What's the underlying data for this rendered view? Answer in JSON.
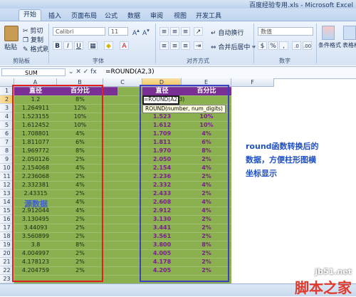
{
  "window": {
    "title": "百度经验专用.xls - Microsoft Excel"
  },
  "tabs": [
    "开始",
    "插入",
    "页面布局",
    "公式",
    "数据",
    "审阅",
    "视图",
    "开发工具"
  ],
  "ribbon": {
    "paste": "粘贴",
    "cut": "剪切",
    "copy": "复制",
    "format_painter": "格式刷",
    "font_name": "Calibri",
    "font_size": "11",
    "bold": "B",
    "italic": "I",
    "underline": "U",
    "wrap_text": "自动换行",
    "merge_center": "合并后居中",
    "number_format": "数值",
    "conditional_format": "条件格式",
    "table_format": "表格格",
    "groups": {
      "clipboard": "剪贴板",
      "font": "字体",
      "alignment": "对齐方式",
      "number": "数字"
    }
  },
  "formula_bar": {
    "name_box": "SUM",
    "icons": "⌄ ✕ ✓ fx",
    "formula": "=ROUND(A2,3)"
  },
  "columns": [
    "A",
    "B",
    "C",
    "D",
    "E",
    "F"
  ],
  "rows": [
    "1",
    "2",
    "3",
    "4",
    "5",
    "6",
    "7",
    "8",
    "9",
    "10",
    "11",
    "12",
    "13",
    "14",
    "15",
    "16",
    "17",
    "18",
    "19",
    "20",
    "21",
    "22",
    "23"
  ],
  "sheet": {
    "header_left": [
      "直径",
      "百分比"
    ],
    "header_right": [
      "直径",
      "百分比"
    ],
    "left_rows": [
      [
        "1.2",
        "8%"
      ],
      [
        "1.264911",
        "12%"
      ],
      [
        "1.523155",
        "10%"
      ],
      [
        "1.612452",
        "10%"
      ],
      [
        "1.708801",
        "4%"
      ],
      [
        "1.811077",
        "6%"
      ],
      [
        "1.969772",
        "8%"
      ],
      [
        "2.050126",
        "2%"
      ],
      [
        "2.154068",
        "4%"
      ],
      [
        "2.236068",
        "2%"
      ],
      [
        "2.332381",
        "4%"
      ],
      [
        "2.43315",
        "2%"
      ],
      [
        "",
        "4%"
      ],
      [
        "2.912044",
        "4%"
      ],
      [
        "3.130495",
        "2%"
      ],
      [
        "3.44093",
        "2%"
      ],
      [
        "3.560899",
        "2%"
      ],
      [
        "3.8",
        "8%"
      ],
      [
        "4.004997",
        "2%"
      ],
      [
        "4.178123",
        "2%"
      ],
      [
        "4.204759",
        "2%"
      ]
    ],
    "right_rows": [
      [
        "=ROUND(A2,3)",
        ""
      ],
      [
        "",
        ""
      ],
      [
        "1.523",
        "10%"
      ],
      [
        "1.612",
        "10%"
      ],
      [
        "1.709",
        "4%"
      ],
      [
        "1.811",
        "6%"
      ],
      [
        "1.970",
        "8%"
      ],
      [
        "2.050",
        "2%"
      ],
      [
        "2.154",
        "4%"
      ],
      [
        "2.236",
        "2%"
      ],
      [
        "2.332",
        "4%"
      ],
      [
        "2.433",
        "2%"
      ],
      [
        "2.608",
        "4%"
      ],
      [
        "2.912",
        "4%"
      ],
      [
        "3.130",
        "2%"
      ],
      [
        "3.441",
        "2%"
      ],
      [
        "3.561",
        "2%"
      ],
      [
        "3.800",
        "8%"
      ],
      [
        "4.005",
        "2%"
      ],
      [
        "4.178",
        "2%"
      ],
      [
        "4.205",
        "2%"
      ]
    ]
  },
  "tooltip": {
    "text": "ROUND(number, num_digits)"
  },
  "source_label": "源数据",
  "annotation": [
    "round函数转换后的",
    "数据，方便柱形图横",
    "坐标显示"
  ],
  "watermark": {
    "site": "jb51.net",
    "brand": "脚本之家"
  },
  "colors": {
    "sheet_fill": "#8bb04f",
    "header_band": "#7a2f95",
    "red_box": "#e02020",
    "blue_box": "#3b3fc0"
  }
}
